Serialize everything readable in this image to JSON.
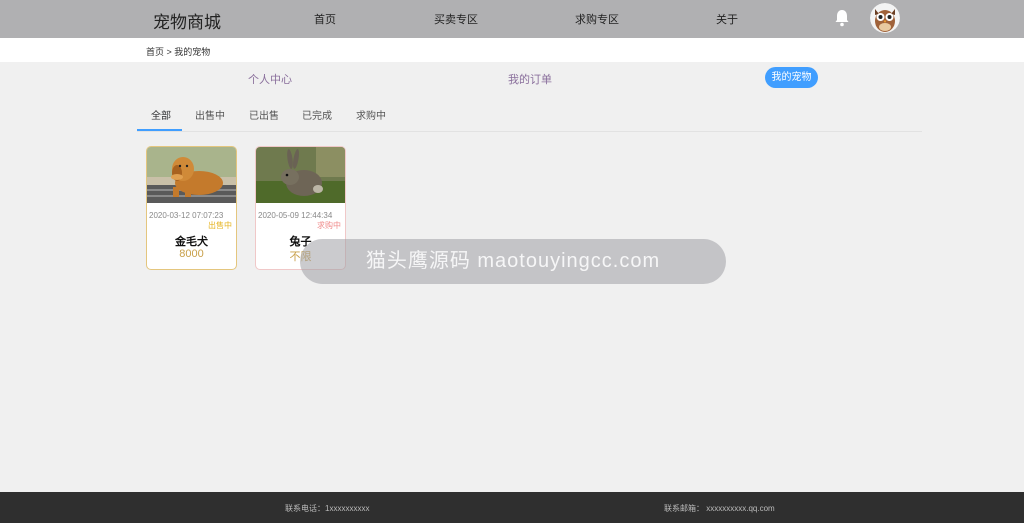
{
  "header": {
    "logo": "宠物商城",
    "nav": [
      "首页",
      "买卖专区",
      "求购专区",
      "关于"
    ]
  },
  "breadcrumb": "首页 > 我的宠物",
  "subnav": {
    "items": [
      "个人中心",
      "我的订单"
    ],
    "active": "我的宠物"
  },
  "tabs": [
    "全部",
    "出售中",
    "已出售",
    "已完成",
    "求购中"
  ],
  "cards": [
    {
      "date": "2020-03-12 07:07:23",
      "status": "出售中",
      "title": "金毛犬",
      "price": "8000"
    },
    {
      "date": "2020-05-09 12:44:34",
      "status": "求购中",
      "title": "兔子",
      "price": "不限"
    }
  ],
  "toast": "猫头鹰源码 maotouyingcc.com",
  "footer": {
    "phone": "联系电话：1xxxxxxxxxx",
    "email": "联系邮箱：   xxxxxxxxxx.qq.com"
  },
  "colors": {
    "accent": "#409eff",
    "sale": "#e6b422",
    "wanted": "#f08c8c"
  }
}
